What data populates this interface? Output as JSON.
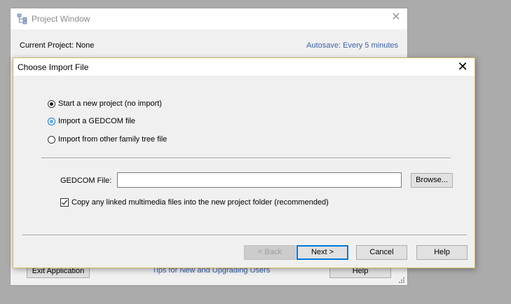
{
  "project_window": {
    "title": "Project Window",
    "current_project": "Current Project: None",
    "autosave": "Autosave: Every 5 minutes",
    "exit_button": "Exit Application",
    "tips_link": "Tips for New and Upgrading Users",
    "help_button": "Help",
    "close_icon": "close-icon",
    "app_icon": "family-tree-icon"
  },
  "dialog": {
    "title": "Choose Import File",
    "close_icon": "close-icon",
    "options": [
      {
        "label": "Start a new project (no import)",
        "selected": true
      },
      {
        "label": "Import a GEDCOM file",
        "selected": false,
        "focused": true
      },
      {
        "label": "Import from other family tree file",
        "selected": false
      }
    ],
    "gedcom_label": "GEDCOM File:",
    "gedcom_value": "",
    "browse_button": "Browse...",
    "copy_multimedia_label": "Copy any linked multimedia files into the new project folder (recommended)",
    "copy_multimedia_checked": true,
    "buttons": {
      "back": "< Back",
      "next": "Next >",
      "cancel": "Cancel",
      "help": "Help"
    }
  },
  "colors": {
    "desktop": "#ababab",
    "link": "#3b63ad",
    "dialog_border": "#d3b66a",
    "default_button_border": "#0078d7"
  }
}
